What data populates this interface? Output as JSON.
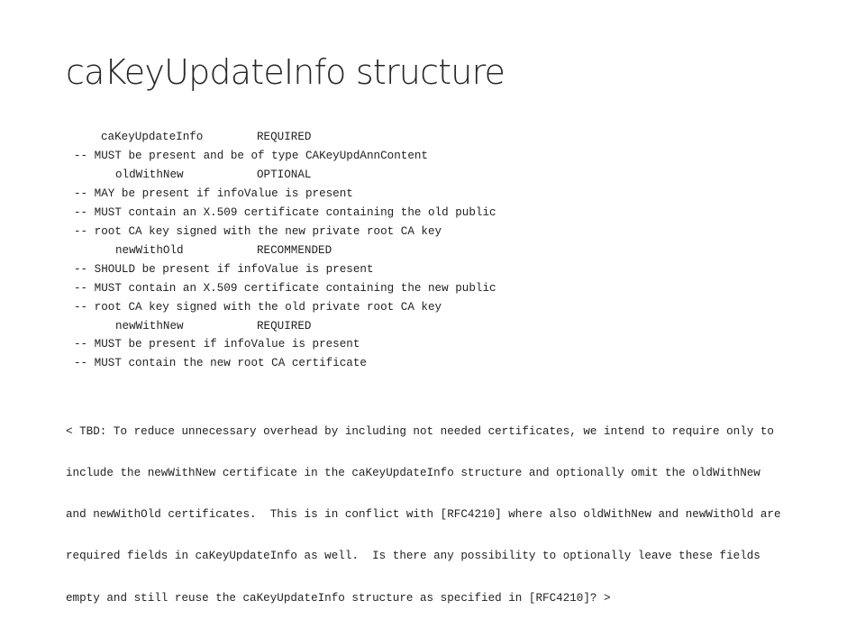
{
  "slide": {
    "title": "caKey.Update.Info structure",
    "title_display": "caKeyUpdateInfo structure"
  },
  "fields": [
    {
      "name": "caKeyUpdateInfo",
      "requirement": "REQUIRED",
      "comments": [
        "-- MUST be present and be of type CAKeyUpdAnnContent"
      ]
    },
    {
      "name": "oldWithNew",
      "requirement": "OPTIONAL",
      "comments": [
        "-- MAY be present if infoValue is present",
        "-- MUST contain an X.509 certificate containing the old public",
        "-- root CA key signed with the new private root CA key"
      ]
    },
    {
      "name": "newWithOld",
      "requirement": "RECOMMENDED",
      "comments": [
        "-- SHOULD be present if infoValue is present",
        "-- MUST contain an X.509 certificate containing the new public",
        "-- root CA key signed with the old private root CA key"
      ]
    },
    {
      "name": "newWithNew",
      "requirement": "REQUIRED",
      "comments": [
        "-- MUST be present if infoValue is present",
        "-- MUST contain the new root CA certificate"
      ]
    }
  ],
  "note": {
    "lines": [
      "< TBD: To reduce unnecessary overhead by including not needed certificates, we intend to require only to",
      "include the newWithNew certificate in the caKeyUpdateInfo structure and optionally omit the oldWithNew",
      "and newWithOld certificates.  This is in conflict with [RFC4210] where also oldWithNew and newWithOld are",
      "required fields in caKeyUpdateInfo as well.  Is there any possibility to optionally leave these fields",
      "empty and still reuse the caKeyUpdateInfo structure as specified in [RFC4210]? >"
    ]
  }
}
